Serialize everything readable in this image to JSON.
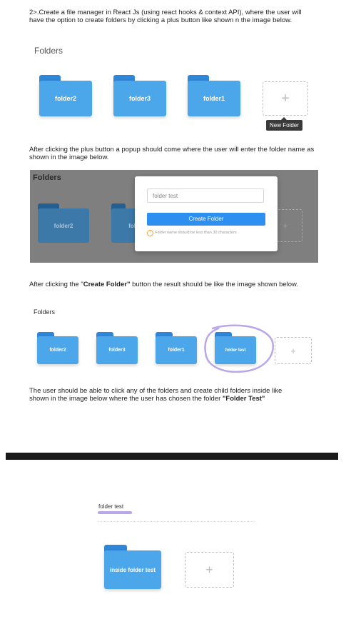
{
  "intro_text": "2>.Create a file manager in React Js (using react hooks & context API), where the user will have the option to create folders by clicking a plus button like shown  n the image below.",
  "section1": {
    "title": "Folders",
    "folders": [
      "folder2",
      "folder3",
      "folder1"
    ],
    "plus_symbol": "+",
    "tooltip": "New Folder"
  },
  "paragraph2": "After clicking the plus button a popup should come where the user will enter the folder name as shown in the image below.",
  "section2": {
    "title": "Folders",
    "folders": [
      "folder2",
      "fol"
    ],
    "plus_symbol": "+",
    "modal": {
      "input_value": "folder test",
      "button_label": "Create Folder",
      "warning_icon": "!",
      "warning_text": "Folder name should be less than 30 characters"
    }
  },
  "paragraph3": {
    "before": "After clicking the \"",
    "bold": "Create Folder\"",
    "after": " button the result should be like the image shown below."
  },
  "section3": {
    "title": "Folders",
    "folders": [
      "folder2",
      "folder3",
      "folder1",
      "folder test"
    ],
    "plus_symbol": "+"
  },
  "paragraph4": {
    "before": "The user should be able to click any of the folders and create child folders inside like shown in the image below where the user has chosen the folder ",
    "bold": "\"Folder Test\""
  },
  "section4": {
    "breadcrumb": "folder test",
    "folder": "inside folder test",
    "plus_symbol": "+"
  },
  "colors": {
    "folder_body": "#4ca7ea",
    "folder_tab": "#2f86d6",
    "button": "#2d8ff0",
    "highlight": "#b9a7ea"
  }
}
